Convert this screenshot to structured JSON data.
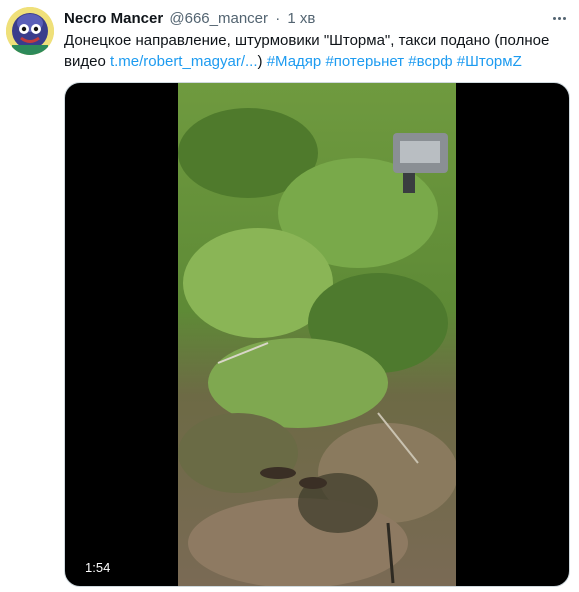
{
  "tweet": {
    "author_name": "Necro Mancer",
    "handle": "@666_mancer",
    "separator": "·",
    "time": "1 хв",
    "text_main": "Донецкое направление, штурмовики \"Шторма\", такси подано (полное видео ",
    "link": "t.me/robert_magyar/...",
    "text_after_link": ") ",
    "hashtags": [
      "#Мадяр",
      "#потерьнет",
      "#всрф",
      "#ШтормZ"
    ],
    "video_duration": "1:54"
  },
  "icons": {
    "more": "more-horizontal-icon",
    "avatar": "avatar-image"
  },
  "colors": {
    "link": "#1d9bf0",
    "secondary_text": "#536471",
    "primary_text": "#0f1419",
    "media_background": "#000000"
  }
}
